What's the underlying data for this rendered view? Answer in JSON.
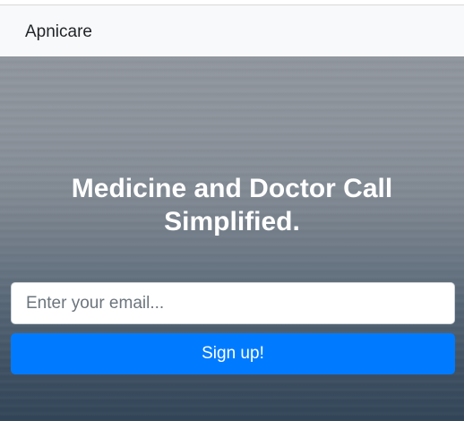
{
  "navbar": {
    "brand": "Apnicare"
  },
  "hero": {
    "headline": "Medicine and Doctor Call Simplified."
  },
  "signup_form": {
    "email_value": "",
    "email_placeholder": "Enter your email...",
    "submit_label": "Sign up!"
  },
  "colors": {
    "primary": "#007bff",
    "navbar_bg": "#f8f9fa",
    "hero_text": "#ffffff"
  }
}
